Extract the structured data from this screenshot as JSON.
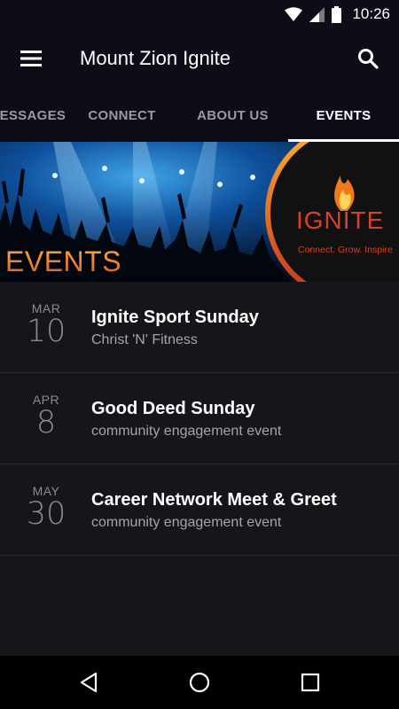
{
  "status_bar": {
    "time": "10:26",
    "icons": [
      "wifi-icon",
      "signal-icon",
      "battery-icon"
    ]
  },
  "app_bar": {
    "menu_icon": "menu-icon",
    "title": "Mount Zion Ignite",
    "search_icon": "search-icon"
  },
  "tabs": [
    {
      "label": "MESSAGES"
    },
    {
      "label": "CONNECT"
    },
    {
      "label": "ABOUT US"
    },
    {
      "label": "EVENTS",
      "active": true
    }
  ],
  "banner": {
    "heading": "EVENTS",
    "logo_text": "IGNITE",
    "tagline": "Connect. Grow. Inspire"
  },
  "events": [
    {
      "month": "MAR",
      "day": "10",
      "title": "Ignite Sport Sunday",
      "subtitle": "Christ 'N' Fitness"
    },
    {
      "month": "APR",
      "day": "8",
      "title": "Good Deed Sunday",
      "subtitle": "community engagement event"
    },
    {
      "month": "MAY",
      "day": "30",
      "title": "Career Network Meet & Greet",
      "subtitle": "community engagement event"
    }
  ],
  "nav_bar": {
    "icons": [
      "back-icon",
      "home-icon",
      "recents-icon"
    ]
  },
  "colors": {
    "header_bg": "#0d0d18",
    "list_bg": "#151619",
    "accent_orange": "#f07a1a",
    "logo_red": "#d8402a"
  }
}
